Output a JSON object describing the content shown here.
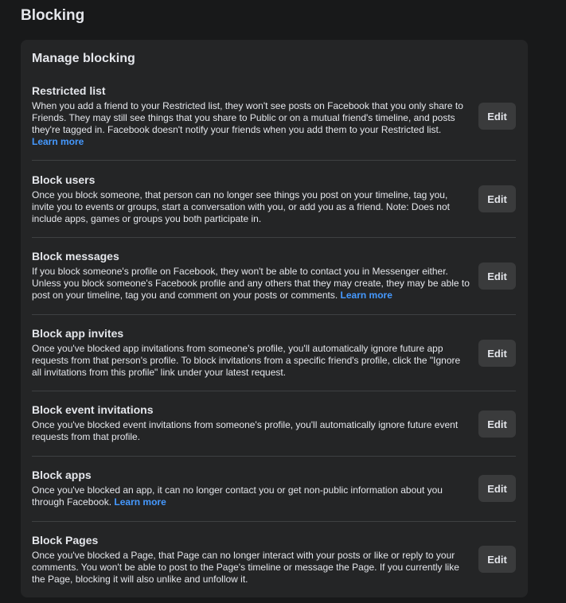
{
  "page": {
    "title": "Blocking"
  },
  "card": {
    "title": "Manage blocking"
  },
  "sections": [
    {
      "title": "Restricted list",
      "description": "When you add a friend to your Restricted list, they won't see posts on Facebook that you only share to Friends. They may still see things that you share to Public or on a mutual friend's timeline, and posts they're tagged in. Facebook doesn't notify your friends when you add them to your Restricted list.",
      "link": "Learn more",
      "button": "Edit"
    },
    {
      "title": "Block users",
      "description": "Once you block someone, that person can no longer see things you post on your timeline, tag you, invite you to events or groups, start a conversation with you, or add you as a friend. Note: Does not include apps, games or groups you both participate in.",
      "link": "",
      "button": "Edit"
    },
    {
      "title": "Block messages",
      "description": "If you block someone's profile on Facebook, they won't be able to contact you in Messenger either. Unless you block someone's Facebook profile and any others that they may create, they may be able to post on your timeline, tag you and comment on your posts or comments.",
      "link": "Learn more",
      "button": "Edit"
    },
    {
      "title": "Block app invites",
      "description": "Once you've blocked app invitations from someone's profile, you'll automatically ignore future app requests from that person's profile. To block invitations from a specific friend's profile, click the \"Ignore all invitations from this profile\" link under your latest request.",
      "link": "",
      "button": "Edit"
    },
    {
      "title": "Block event invitations",
      "description": "Once you've blocked event invitations from someone's profile, you'll automatically ignore future event requests from that profile.",
      "link": "",
      "button": "Edit"
    },
    {
      "title": "Block apps",
      "description": "Once you've blocked an app, it can no longer contact you or get non-public information about you through Facebook.",
      "link": "Learn more",
      "button": "Edit"
    },
    {
      "title": "Block Pages",
      "description": "Once you've blocked a Page, that Page can no longer interact with your posts or like or reply to your comments. You won't be able to post to the Page's timeline or message the Page. If you currently like the Page, blocking it will also unlike and unfollow it.",
      "link": "",
      "button": "Edit"
    }
  ],
  "colors": {
    "background": "#18191a",
    "card": "#242526",
    "button": "#3a3b3c",
    "link": "#4599ff",
    "divider": "#3e4042"
  }
}
